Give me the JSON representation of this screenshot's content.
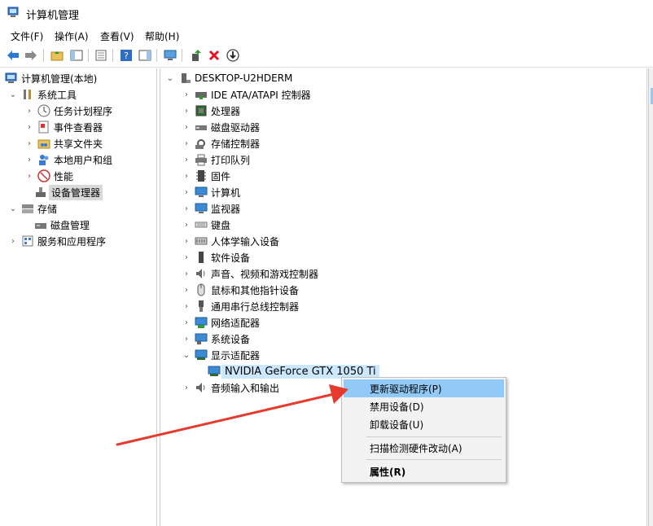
{
  "window": {
    "title": "计算机管理"
  },
  "menu": [
    "文件(F)",
    "操作(A)",
    "查看(V)",
    "帮助(H)"
  ],
  "toolbar": [
    {
      "icon": "back-arrow-icon"
    },
    {
      "icon": "forward-arrow-icon"
    },
    {
      "icon": "up-folder-icon"
    },
    {
      "icon": "show-hide-console-tree-icon"
    },
    {
      "icon": "properties-icon"
    },
    {
      "icon": "help-icon"
    },
    {
      "icon": "action-pane-icon"
    },
    {
      "icon": "monitor-icon"
    },
    {
      "icon": "update-driver-icon"
    },
    {
      "icon": "uninstall-icon"
    },
    {
      "icon": "disable-device-icon"
    }
  ],
  "left_tree": {
    "root": "计算机管理(本地)",
    "system_tools": "系统工具",
    "task_scheduler": "任务计划程序",
    "event_viewer": "事件查看器",
    "shared_folders": "共享文件夹",
    "local_users": "本地用户和组",
    "performance": "性能",
    "device_manager": "设备管理器",
    "storage": "存储",
    "disk_management": "磁盘管理",
    "services_apps": "服务和应用程序"
  },
  "right_tree": {
    "root": "DESKTOP-U2HDERM",
    "items": [
      "IDE ATA/ATAPI 控制器",
      "处理器",
      "磁盘驱动器",
      "存储控制器",
      "打印队列",
      "固件",
      "计算机",
      "监视器",
      "键盘",
      "人体学输入设备",
      "软件设备",
      "声音、视频和游戏控制器",
      "鼠标和其他指针设备",
      "通用串行总线控制器",
      "网络适配器",
      "系统设备",
      "显示适配器"
    ],
    "display_child": "NVIDIA GeForce GTX 1050 Ti",
    "audio_io": "音频输入和输出"
  },
  "context_menu": {
    "update_driver": "更新驱动程序(P)",
    "disable_device": "禁用设备(D)",
    "uninstall_device": "卸载设备(U)",
    "scan_changes": "扫描检测硬件改动(A)",
    "properties": "属性(R)"
  },
  "colors": {
    "accent": "#0078d7",
    "highlight": "#91c9f7",
    "arrow": "#e63a2e",
    "uninstall": "#e81123"
  }
}
